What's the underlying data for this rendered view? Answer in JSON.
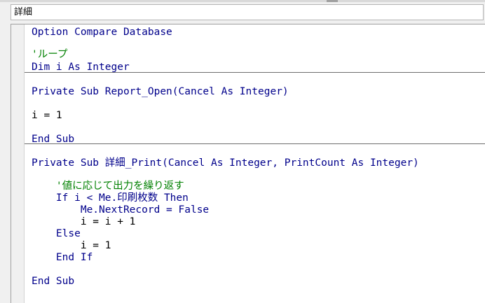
{
  "object_combo": {
    "value": "詳細"
  },
  "code_lines": [
    "Option Compare Database",
    "",
    "'ループ",
    "Dim i As Integer",
    "",
    "Private Sub Report_Open(Cancel As Integer)",
    "",
    "i = 1",
    "",
    "End Sub",
    "",
    "Private Sub 詳細_Print(Cancel As Integer, PrintCount As Integer)",
    "",
    "    '値に応じて出力を繰り返す",
    "    If i < Me.印刷枚数 Then",
    "        Me.NextRecord = False",
    "        i = i + 1",
    "    Else",
    "        i = 1",
    "    End If",
    "",
    "End Sub"
  ],
  "colors": {
    "keyword_text": "#00008b",
    "comment_text": "#008000",
    "plain_text": "#000000",
    "procedure_separator": "#6e6e6e"
  }
}
